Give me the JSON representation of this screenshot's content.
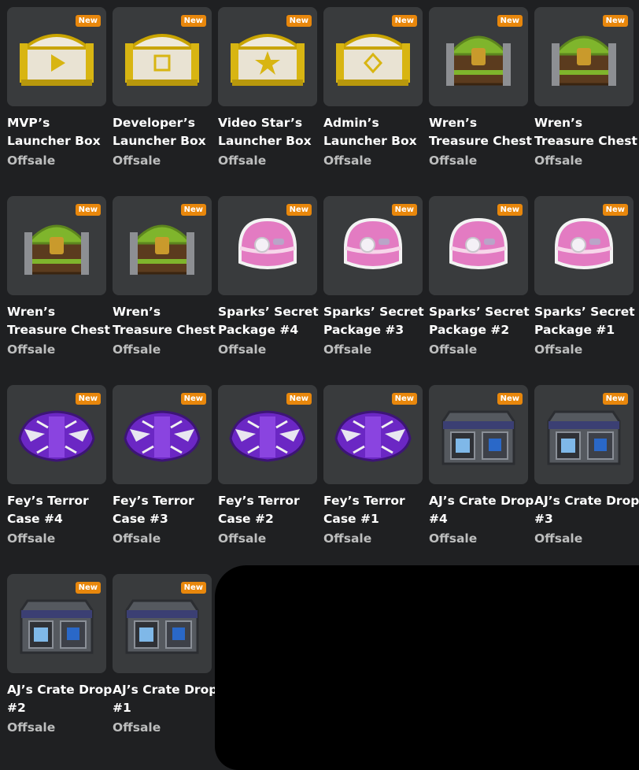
{
  "colors": {
    "background": "#1f2022",
    "card": "#393b3d",
    "badge": "#e8870c",
    "offsale": "#bdbebe"
  },
  "items": [
    {
      "name": "MVP’s Launcher Box",
      "price": "Offsale",
      "badge": "New",
      "icon": "gold-launcher-box-play-icon"
    },
    {
      "name": "Developer’s Launcher Box",
      "price": "Offsale",
      "badge": "New",
      "icon": "gold-launcher-box-square-icon"
    },
    {
      "name": "Video Star’s Launcher Box",
      "price": "Offsale",
      "badge": "New",
      "icon": "gold-launcher-box-star-icon"
    },
    {
      "name": "Admin’s Launcher Box",
      "price": "Offsale",
      "badge": "New",
      "icon": "gold-launcher-box-diamond-icon"
    },
    {
      "name": "Wren’s Treasure Chest",
      "price": "Offsale",
      "badge": "New",
      "icon": "green-treasure-chest-icon"
    },
    {
      "name": "Wren’s Treasure Chest",
      "price": "Offsale",
      "badge": "New",
      "icon": "green-treasure-chest-icon"
    },
    {
      "name": "Wren’s Treasure Chest",
      "price": "Offsale",
      "badge": "New",
      "icon": "green-treasure-chest-icon"
    },
    {
      "name": "Wren’s Treasure Chest",
      "price": "Offsale",
      "badge": "New",
      "icon": "green-treasure-chest-icon"
    },
    {
      "name": "Sparks’ Secret Package #4",
      "price": "Offsale",
      "badge": "New",
      "icon": "pink-package-icon"
    },
    {
      "name": "Sparks’ Secret Package #3",
      "price": "Offsale",
      "badge": "New",
      "icon": "pink-package-icon"
    },
    {
      "name": "Sparks’ Secret Package #2",
      "price": "Offsale",
      "badge": "New",
      "icon": "pink-package-icon"
    },
    {
      "name": "Sparks’ Secret Package #1",
      "price": "Offsale",
      "badge": "New",
      "icon": "pink-package-icon"
    },
    {
      "name": "Fey’s Terror Case #4",
      "price": "Offsale",
      "badge": "New",
      "icon": "purple-terror-case-icon"
    },
    {
      "name": "Fey’s Terror Case #3",
      "price": "Offsale",
      "badge": "New",
      "icon": "purple-terror-case-icon"
    },
    {
      "name": "Fey’s Terror Case #2",
      "price": "Offsale",
      "badge": "New",
      "icon": "purple-terror-case-icon"
    },
    {
      "name": "Fey’s Terror Case #1",
      "price": "Offsale",
      "badge": "New",
      "icon": "purple-terror-case-icon"
    },
    {
      "name": "AJ’s Crate Drop #4",
      "price": "Offsale",
      "badge": "New",
      "icon": "steel-crate-icon"
    },
    {
      "name": "AJ’s Crate Drop #3",
      "price": "Offsale",
      "badge": "New",
      "icon": "steel-crate-icon"
    },
    {
      "name": "AJ’s Crate Drop #2",
      "price": "Offsale",
      "badge": "New",
      "icon": "steel-crate-icon"
    },
    {
      "name": "AJ’s Crate Drop #1",
      "price": "Offsale",
      "badge": "New",
      "icon": "steel-crate-icon"
    }
  ]
}
